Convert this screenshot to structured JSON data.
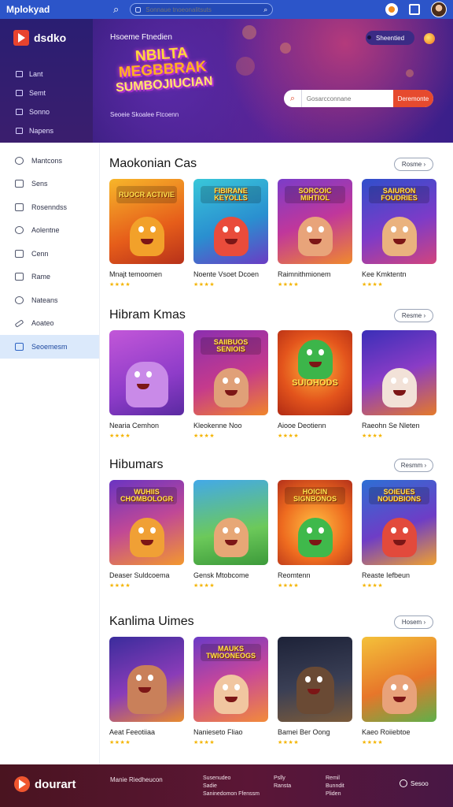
{
  "topbar": {
    "brand": "Mplokyad",
    "search_placeholder": "Sonnaue tnoeonalitsuts",
    "icons": [
      "search-icon",
      "grid-icon",
      "search-icon",
      "notification-icon",
      "cart-icon",
      "avatar"
    ]
  },
  "sidebar": {
    "logo_text": "dsdko",
    "top_items": [
      {
        "label": "Lant",
        "icon": "list-icon"
      },
      {
        "label": "Semt",
        "icon": "grid-icon"
      },
      {
        "label": "Sonno",
        "icon": "gamepad-icon"
      },
      {
        "label": "Napens",
        "icon": "map-icon"
      }
    ],
    "items": [
      {
        "label": "Mantcons",
        "icon": "clock-icon"
      },
      {
        "label": "Sens",
        "icon": "user-icon"
      },
      {
        "label": "Rosenndss",
        "icon": "grid-icon"
      },
      {
        "label": "Aolentne",
        "icon": "compass-icon"
      },
      {
        "label": "Cenn",
        "icon": "calendar-icon"
      },
      {
        "label": "Rame",
        "icon": "square-icon"
      },
      {
        "label": "Nateans",
        "icon": "circle-icon"
      },
      {
        "label": "Aoateo",
        "icon": "pen-icon"
      },
      {
        "label": "Seoemesm",
        "icon": "card-icon"
      }
    ],
    "active_index": 8
  },
  "hero": {
    "label": "Hsoeme Ftnedien",
    "title_line1": "NBILTA",
    "title_line2": "MEGBBRAK",
    "title_line3": "SUMBOJIUCIAN",
    "subtitle": "Seoeie Skoalee Ftcoenn",
    "chip": "Sheentied",
    "search_placeholder": "Gosarcconnane",
    "search_button": "Deremonte"
  },
  "sections": [
    {
      "title": "Maokonian Cas",
      "more": "Rosme ›",
      "cards": [
        {
          "name": "Mnajt temoomen",
          "badge": "RUOCR ACTIVIE",
          "stars": "★★★★"
        },
        {
          "name": "Noente Vsoet Dcoen",
          "badge": "FIBIRANE KEYOLLS",
          "stars": "★★★★"
        },
        {
          "name": "Raimnithmionem",
          "badge": "SORCOIC MIHTIOL",
          "stars": "★★★★"
        },
        {
          "name": "Kee Kmktentn",
          "badge": "SAIURON FOUDRIES",
          "stars": "★★★★"
        }
      ]
    },
    {
      "title": "Hibram Kmas",
      "more": "Resme ›",
      "cards": [
        {
          "name": "Nearia Cemhon",
          "badge": "",
          "stars": "★★★★"
        },
        {
          "name": "Kleokenne Noo",
          "badge": "SAIIBUOS SENIOIS",
          "stars": "★★★★"
        },
        {
          "name": "Aiooe Deotienn",
          "badge": "SUIOHODS",
          "stars": "★★★★"
        },
        {
          "name": "Raeohn Se Nleten",
          "badge": "",
          "stars": "★★★★"
        }
      ]
    },
    {
      "title": "Hibumars",
      "more": "Resmm ›",
      "cards": [
        {
          "name": "Deaser Suldcoema",
          "badge": "WUHIIS CHOMBOLOGR",
          "stars": "★★★★"
        },
        {
          "name": "Gensk Mtobcome",
          "badge": "",
          "stars": "★★★★"
        },
        {
          "name": "Reomtenn",
          "badge": "HOICIN SIGNBONOS",
          "stars": "★★★★"
        },
        {
          "name": "Reaste Iefbeun",
          "badge": "SOIEUES NOUDBIONS",
          "stars": "★★★★"
        }
      ]
    },
    {
      "title": "Kanlima Uimes",
      "more": "Hosem ›",
      "cards": [
        {
          "name": "Aeat Feeotiiaa",
          "badge": "",
          "stars": "★★★★"
        },
        {
          "name": "Nanieseto Fliao",
          "badge": "MAUKS TWIOONEOGS",
          "stars": "★★★★"
        },
        {
          "name": "Bamei Ber Oong",
          "badge": "",
          "stars": "★★★★"
        },
        {
          "name": "Kaeo Roiiebtoe",
          "badge": "",
          "stars": "★★★★"
        }
      ]
    }
  ],
  "footer": {
    "logo_text": "dourart",
    "col1": "Manie Riedheucon",
    "col2_lines": [
      "Susenudeo",
      "Sadie",
      "Saninedomon Ffenssm"
    ],
    "col3_lines": [
      "Pslly",
      "Ransta"
    ],
    "col4_lines": [
      "Remil",
      "Bunndit",
      "Pliden"
    ],
    "contact": "Sesoo"
  },
  "colors": {
    "topbar": "#2c55c9",
    "accent": "#e64a2e",
    "active_sidebar": "#dbe9fb",
    "star": "#f4b400",
    "footer": "#4a1420"
  }
}
